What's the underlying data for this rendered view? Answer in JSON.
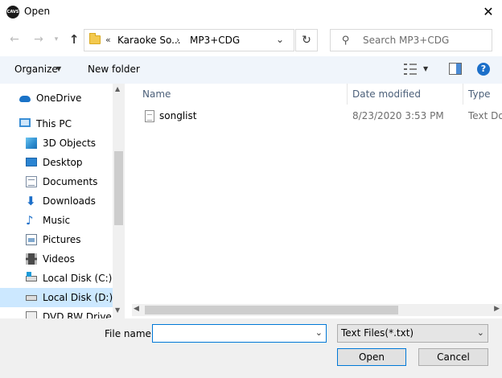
{
  "window": {
    "title": "Open",
    "app_icon_text": "CAVS"
  },
  "nav": {
    "breadcrumb_more": "«",
    "breadcrumb": [
      "Karaoke So...",
      "MP3+CDG"
    ],
    "separator": "›",
    "search_placeholder": "Search MP3+CDG"
  },
  "toolbar": {
    "organize_label": "Organize",
    "new_folder_label": "New folder",
    "help_label": "?"
  },
  "sidebar": {
    "items": [
      {
        "label": "OneDrive",
        "icon": "cloud-icon"
      },
      {
        "label": "This PC",
        "icon": "computer-icon"
      },
      {
        "label": "3D Objects",
        "icon": "cube-icon"
      },
      {
        "label": "Desktop",
        "icon": "desktop-icon"
      },
      {
        "label": "Documents",
        "icon": "document-icon"
      },
      {
        "label": "Downloads",
        "icon": "download-icon"
      },
      {
        "label": "Music",
        "icon": "music-icon"
      },
      {
        "label": "Pictures",
        "icon": "picture-icon"
      },
      {
        "label": "Videos",
        "icon": "video-icon"
      },
      {
        "label": "Local Disk (C:)",
        "icon": "drive-icon"
      },
      {
        "label": "Local Disk (D:)",
        "icon": "drive-icon",
        "selected": true
      },
      {
        "label": "DVD RW Drive (E",
        "icon": "dvd-drive-icon"
      }
    ]
  },
  "file_list": {
    "columns": [
      "Name",
      "Date modified",
      "Type"
    ],
    "rows": [
      {
        "name": "songlist",
        "date_modified": "8/23/2020 3:53 PM",
        "type": "Text Doc"
      }
    ]
  },
  "footer": {
    "file_name_label": "File name:",
    "file_name_value": "",
    "filter_value": "Text Files(*.txt)",
    "open_label": "Open",
    "cancel_label": "Cancel"
  },
  "colors": {
    "accent": "#0078d7",
    "selection": "#cce8ff",
    "toolbar_bg": "#f0f5fb",
    "footer_bg": "#f0f0f0"
  }
}
